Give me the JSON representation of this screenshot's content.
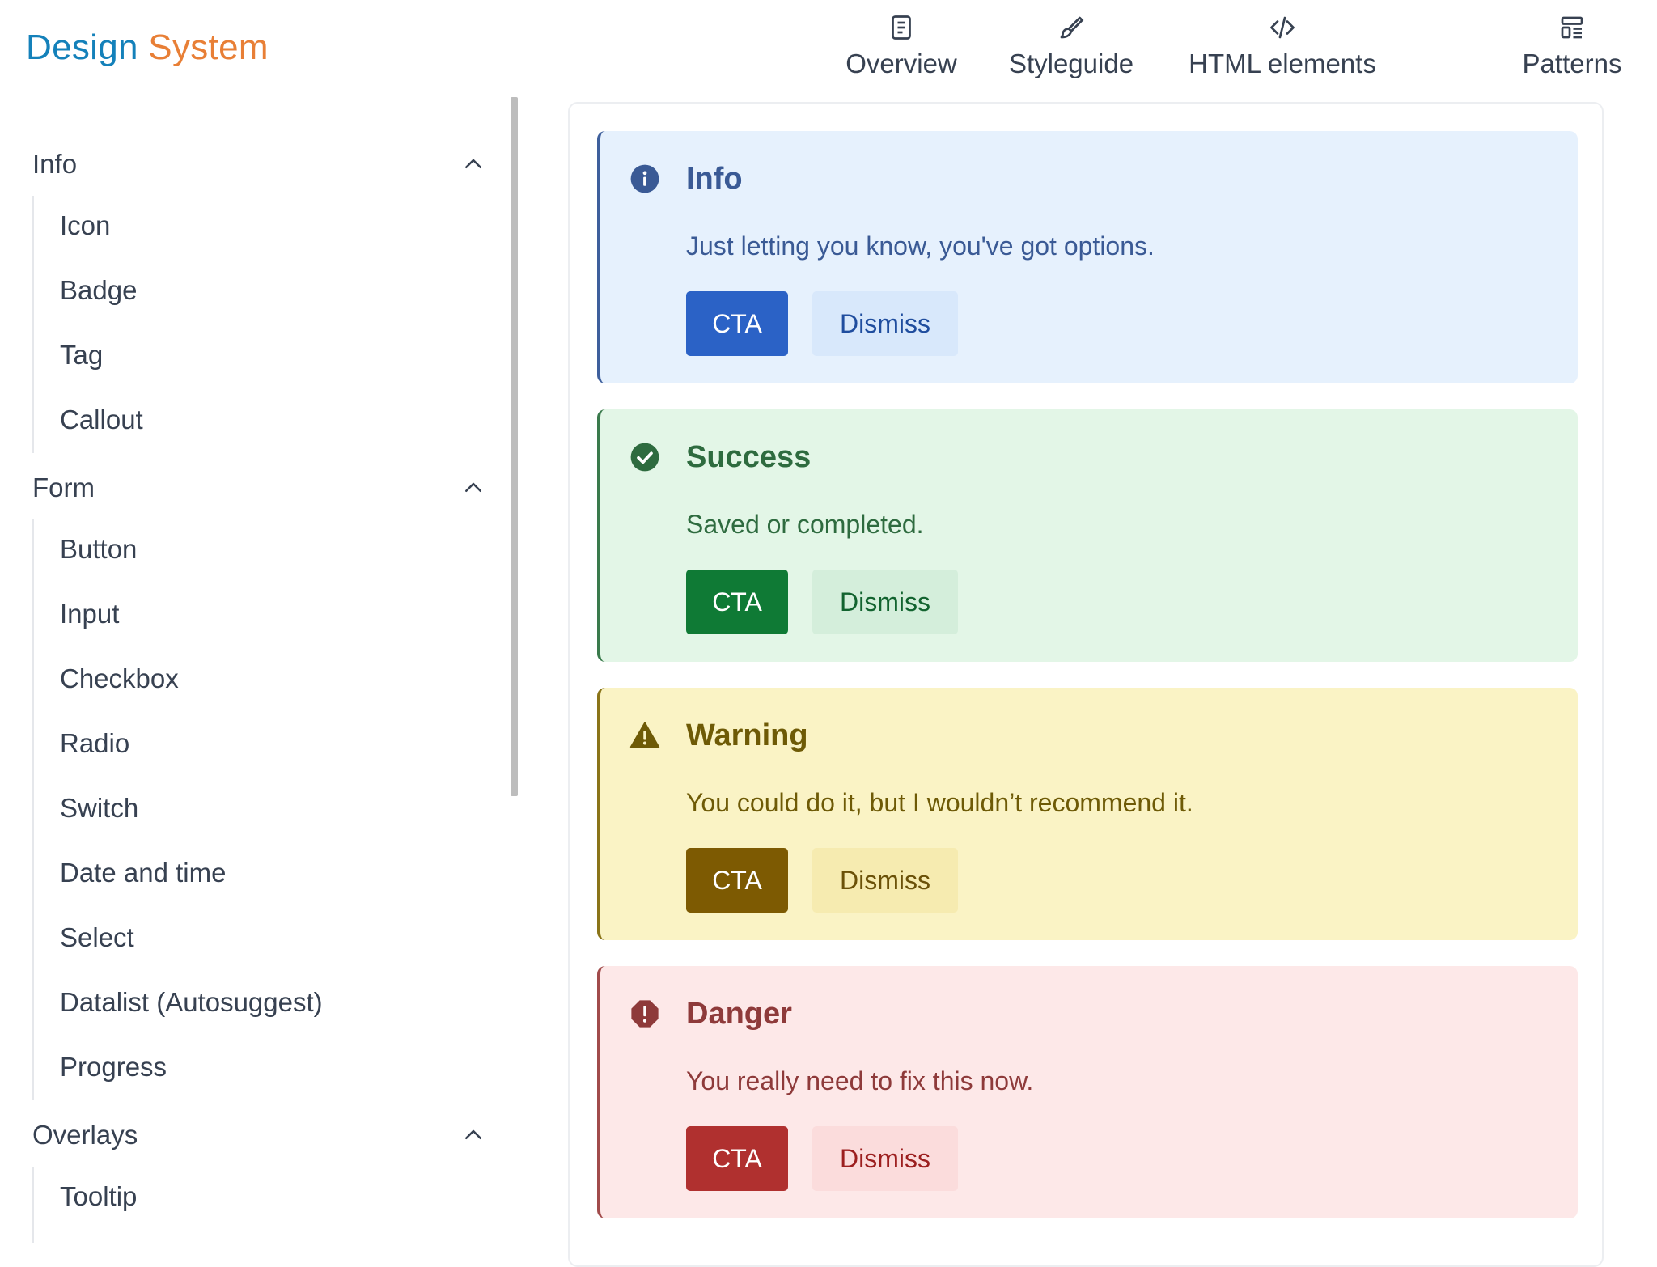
{
  "brand": {
    "part1": "Design",
    "part2": "System"
  },
  "topnav": {
    "items": [
      {
        "label": "Overview",
        "icon": "document-icon"
      },
      {
        "label": "Styleguide",
        "icon": "brush-icon"
      },
      {
        "label": "HTML elements",
        "icon": "code-icon"
      },
      {
        "label": "Patterns",
        "icon": "layout-icon"
      }
    ]
  },
  "sidebar": {
    "groups": [
      {
        "label": "Info",
        "items": [
          "Icon",
          "Badge",
          "Tag",
          "Callout"
        ]
      },
      {
        "label": "Form",
        "items": [
          "Button",
          "Input",
          "Checkbox",
          "Radio",
          "Switch",
          "Date and time",
          "Select",
          "Datalist (Autosuggest)",
          "Progress"
        ]
      },
      {
        "label": "Overlays",
        "items": [
          "Tooltip"
        ]
      }
    ]
  },
  "callouts": [
    {
      "title": "Info",
      "text": "Just letting you know, you've got options.",
      "cta": "CTA",
      "dismiss": "Dismiss",
      "icon": "info-circle-icon",
      "colors": {
        "bg": "#e6f1fd",
        "border": "#3e5f9c",
        "title": "#3a5a95",
        "text": "#3a5a95",
        "cta_bg": "#2b62c6",
        "dismiss_bg": "#d8e8fb",
        "dismiss_text": "#1f4d9e"
      }
    },
    {
      "title": "Success",
      "text": "Saved or completed.",
      "cta": "CTA",
      "dismiss": "Dismiss",
      "icon": "check-circle-icon",
      "colors": {
        "bg": "#e3f6e7",
        "border": "#3a7a4c",
        "title": "#2e6b3f",
        "text": "#2e6b3f",
        "cta_bg": "#0f7a35",
        "dismiss_bg": "#d4eedb",
        "dismiss_text": "#12632f"
      }
    },
    {
      "title": "Warning",
      "text": "You could do it, but I wouldn’t recommend it.",
      "cta": "CTA",
      "dismiss": "Dismiss",
      "icon": "warning-triangle-icon",
      "colors": {
        "bg": "#faf3c5",
        "border": "#8a7418",
        "title": "#6e5a06",
        "text": "#6e5a06",
        "cta_bg": "#7d5a02",
        "dismiss_bg": "#f6ebb0",
        "dismiss_text": "#6b5108"
      }
    },
    {
      "title": "Danger",
      "text": "You really need to fix this now.",
      "cta": "CTA",
      "dismiss": "Dismiss",
      "icon": "danger-octagon-icon",
      "colors": {
        "bg": "#fde8e8",
        "border": "#a14b4b",
        "title": "#8e3a3a",
        "text": "#8e3a3a",
        "cta_bg": "#b0302f",
        "dismiss_bg": "#fbdcdc",
        "dismiss_text": "#9c1f1f"
      }
    }
  ]
}
